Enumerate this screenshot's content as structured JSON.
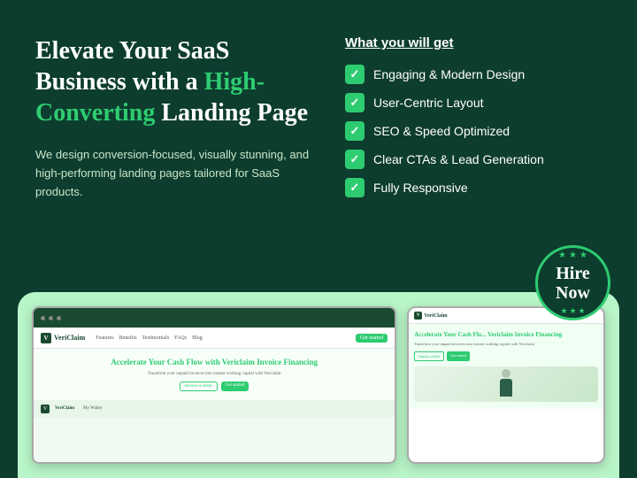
{
  "page": {
    "background_color": "#0d3d2e"
  },
  "headline": {
    "part1": "Elevate Your SaaS",
    "part2": "Business with a ",
    "highlight": "High-Converting",
    "part3": " Landing Page"
  },
  "subtext": "We design conversion-focused, visually stunning, and high-performing landing pages tailored for SaaS products.",
  "what_you_get": {
    "title": "What you will get",
    "features": [
      "Engaging & Modern Design",
      "User-Centric Layout",
      "SEO & Speed Optimized",
      "Clear CTAs & Lead Generation",
      "Fully Responsive"
    ]
  },
  "hire_badge": {
    "line1": "Hire",
    "line2": "Now"
  },
  "mockup": {
    "brand": "VeriClaim",
    "nav_items": [
      "Features",
      "Benefits",
      "Testimonials",
      "FAQs",
      "Blog"
    ],
    "cta": "Get started",
    "hero_title_highlight": "Accelerate",
    "hero_title": " Your Cash Flow with Vericlaim Invoice Financing",
    "hero_sub": "Transform your unpaid invoices into instant working capital with Vericlaim",
    "btn1": "Invoice a client",
    "btn2": "Get started",
    "bottom_brand": "VeriClaim",
    "bottom_label": "My Wallet"
  },
  "mobile_mockup": {
    "brand": "VeriClaim",
    "hero_title_highlight": "Accelerate",
    "hero_title": " Your Cash Flo... Vericlaim Invoice Financing",
    "hero_sub": "Transform your unpaid invoices into instant working capital with Vericlaim",
    "btn1": "Inquire a client",
    "btn2": "Get started"
  }
}
